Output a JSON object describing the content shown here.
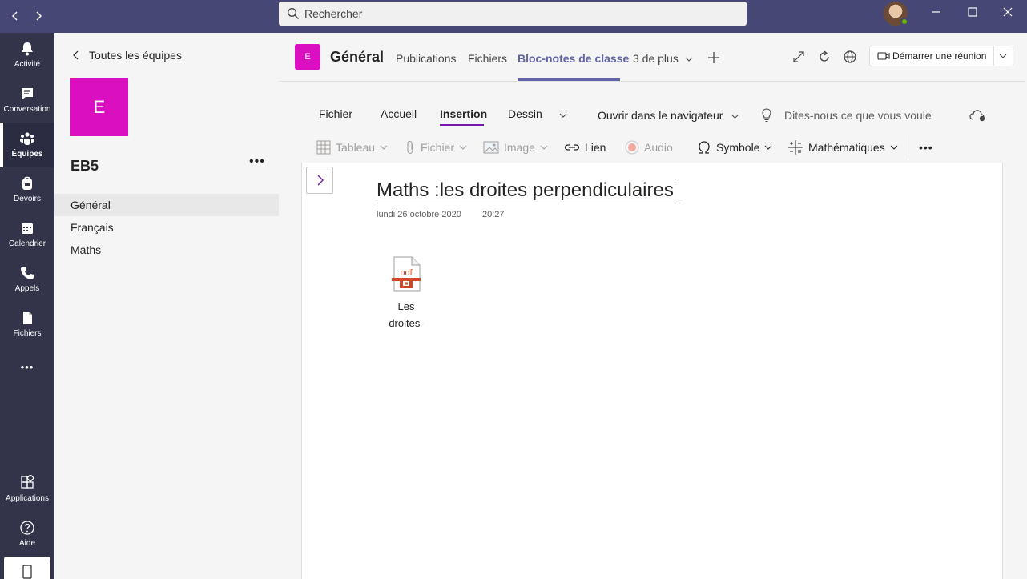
{
  "titlebar": {
    "search_placeholder": "Rechercher",
    "back_icon": "chevron-left-icon",
    "forward_icon": "chevron-right-icon"
  },
  "rail": {
    "items": [
      {
        "label": "Activité",
        "icon": "bell-icon"
      },
      {
        "label": "Conversation",
        "icon": "chat-icon"
      },
      {
        "label": "Équipes",
        "icon": "teams-icon",
        "active": true
      },
      {
        "label": "Devoirs",
        "icon": "backpack-icon"
      },
      {
        "label": "Calendrier",
        "icon": "calendar-icon"
      },
      {
        "label": "Appels",
        "icon": "phone-icon"
      },
      {
        "label": "Fichiers",
        "icon": "file-icon"
      }
    ],
    "more": "•••",
    "apps_label": "Applications",
    "help_label": "Aide"
  },
  "team_panel": {
    "back_label": "Toutes les équipes",
    "team_initial": "E",
    "team_name": "EB5",
    "more": "•••",
    "channels": [
      "Général",
      "Français",
      "Maths"
    ]
  },
  "channel_header": {
    "tile_initial": "E",
    "title": "Général",
    "tabs": [
      "Publications",
      "Fichiers",
      "Bloc-notes de classe",
      "3 de plus"
    ],
    "active_tab": "Bloc-notes de classe",
    "meeting_button": "Démarrer une réunion"
  },
  "ribbon": {
    "tabs": [
      "Fichier",
      "Accueil",
      "Insertion",
      "Dessin"
    ],
    "active_tab": "Insertion",
    "open_in_browser": "Ouvrir dans le navigateur",
    "tell_me": "Dites-nous ce que vous voule",
    "tools": {
      "tableau": "Tableau",
      "fichier": "Fichier",
      "image": "Image",
      "lien": "Lien",
      "audio": "Audio",
      "symbole": "Symbole",
      "mathematiques": "Mathématiques"
    },
    "more": "•••"
  },
  "page": {
    "title": "Maths :les droites perpendiculaires",
    "date": "lundi 26 octobre 2020",
    "time": "20:27",
    "attachment": {
      "type_label": "pdf",
      "name_line1": "Les",
      "name_line2": "droites-"
    }
  },
  "colors": {
    "titlebar": "#464775",
    "rail": "#33344a",
    "team_accent": "#d90fc0",
    "tab_active": "#6264a7",
    "ribbon_accent": "#7719aa",
    "pdf_red": "#d24726",
    "presence": "#6bb700"
  }
}
